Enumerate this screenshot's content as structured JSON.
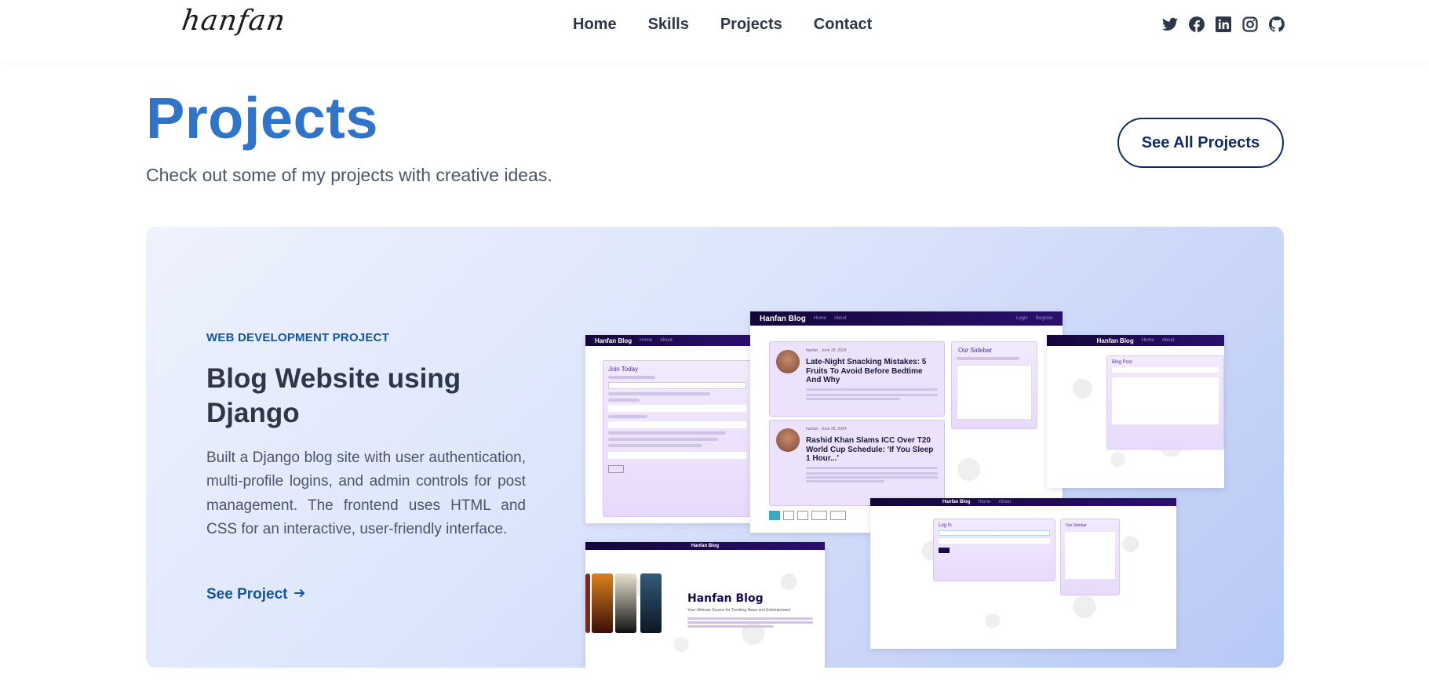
{
  "brand": {
    "logo_text": "hanfan"
  },
  "nav": {
    "items": [
      "Home",
      "Skills",
      "Projects",
      "Contact"
    ]
  },
  "socials": [
    "twitter-icon",
    "facebook-icon",
    "linkedin-icon",
    "instagram-icon",
    "github-icon"
  ],
  "header": {
    "title": "Projects",
    "subtitle": "Check out some of my projects with creative ideas.",
    "see_all_label": "See All Projects"
  },
  "project": {
    "tag": "WEB DEVELOPMENT PROJECT",
    "title": "Blog Website using Django",
    "description": "Built a Django blog site with user authentication, multi-profile logins, and admin controls for post management. The frontend uses HTML and CSS for an interactive, user-friendly interface.",
    "link_label": "See Project"
  },
  "preview": {
    "site_name": "Hanfan Blog",
    "sidebar_title": "Our Sidebar",
    "join_title": "Join Today",
    "login_title": "Log In",
    "blog_post_label": "Blog Post",
    "post1_title": "Late-Night Snacking Mistakes: 5 Fruits To Avoid Before Bedtime And Why",
    "post2_title": "Rashid Khan Slams ICC Over T20 World Cup Schedule: 'If You Sleep 1 Hour...'",
    "hero_tagline": "Your Ultimate Source for Trending News and Entertainment"
  },
  "colors": {
    "accent": "#2f74c9",
    "navy": "#0f2a67",
    "link": "#13559e",
    "preview_bar": "#14063a"
  }
}
